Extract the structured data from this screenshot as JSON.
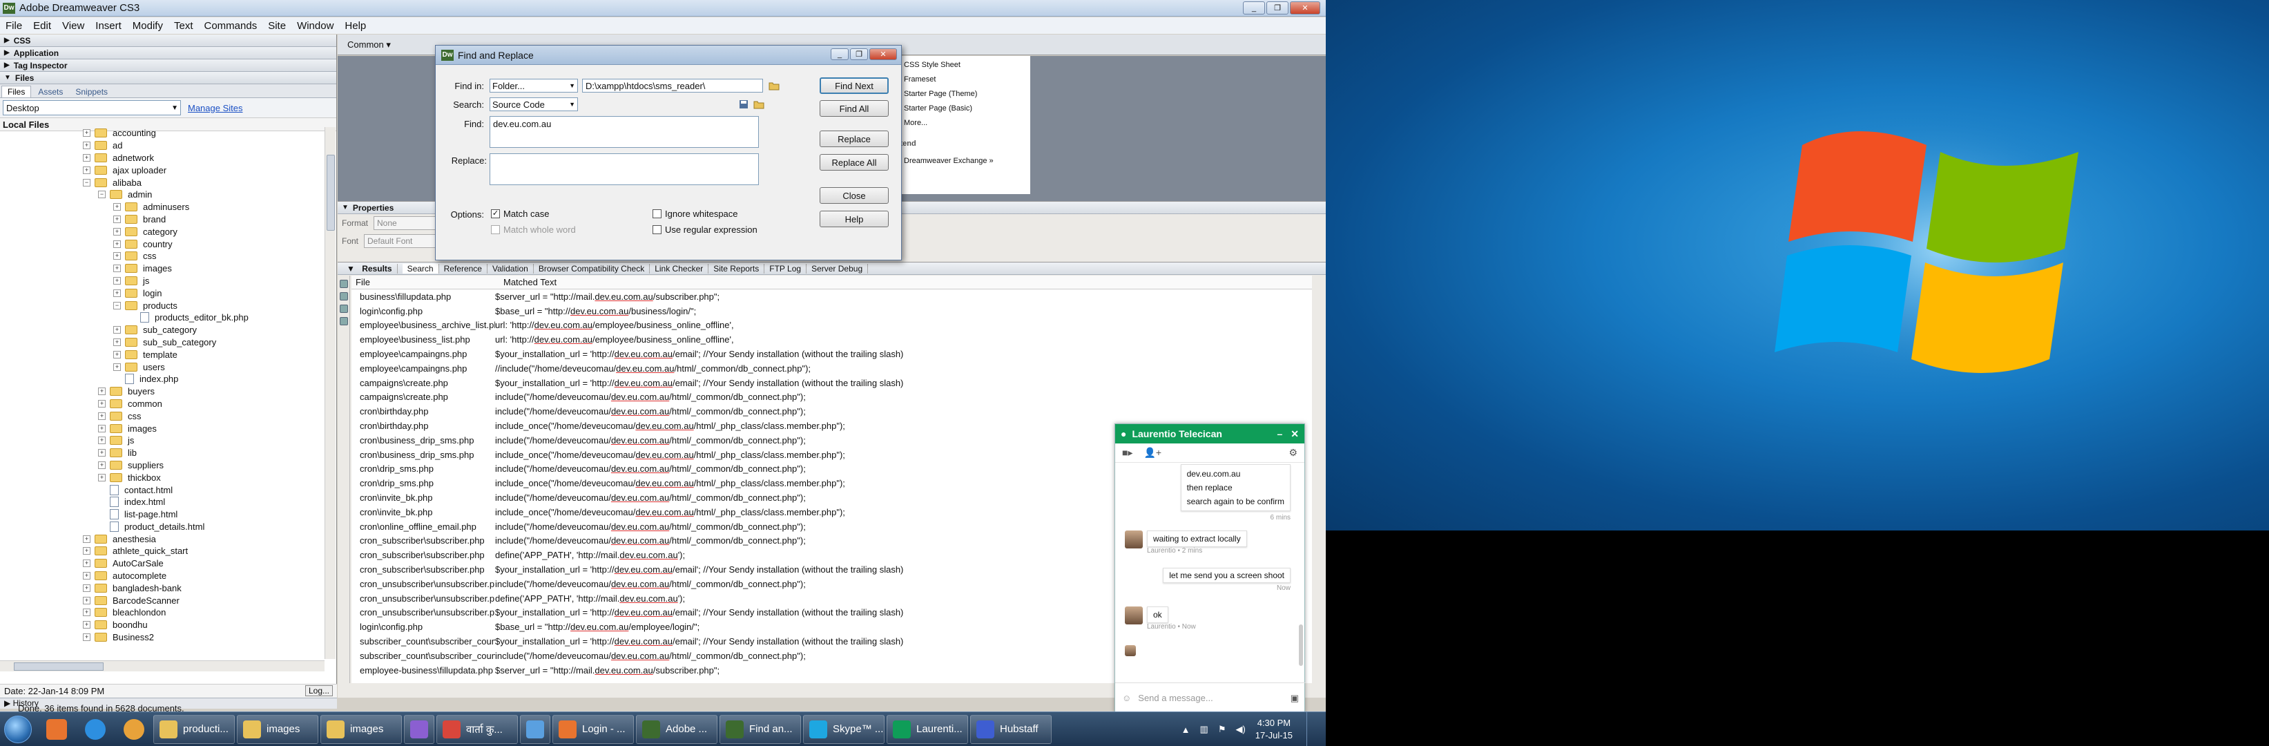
{
  "app": {
    "title": "Adobe Dreamweaver CS3",
    "window_controls": [
      "_",
      "❐",
      "✕"
    ]
  },
  "menu": [
    "File",
    "Edit",
    "View",
    "Insert",
    "Modify",
    "Text",
    "Commands",
    "Site",
    "Window",
    "Help"
  ],
  "panels": {
    "css": "CSS",
    "application": "Application",
    "tag_inspector": "Tag Inspector",
    "files": "Files",
    "files_tabs": [
      "Files",
      "Assets",
      "Snippets"
    ],
    "site": "Desktop",
    "manage_sites": "Manage Sites",
    "local_files": "Local Files",
    "status": "Date: 22-Jan-14 8:09 PM",
    "log_button": "Log...",
    "history": "History"
  },
  "tree": [
    {
      "name": "accounting",
      "level": 0,
      "type": "folder",
      "exp": "+"
    },
    {
      "name": "ad",
      "level": 0,
      "type": "folder",
      "exp": "+"
    },
    {
      "name": "adnetwork",
      "level": 0,
      "type": "folder",
      "exp": "+"
    },
    {
      "name": "ajax uploader",
      "level": 0,
      "type": "folder",
      "exp": "+"
    },
    {
      "name": "alibaba",
      "level": 0,
      "type": "folder",
      "exp": "−"
    },
    {
      "name": "admin",
      "level": 1,
      "type": "folder",
      "exp": "−"
    },
    {
      "name": "adminusers",
      "level": 2,
      "type": "folder",
      "exp": "+"
    },
    {
      "name": "brand",
      "level": 2,
      "type": "folder",
      "exp": "+"
    },
    {
      "name": "category",
      "level": 2,
      "type": "folder",
      "exp": "+"
    },
    {
      "name": "country",
      "level": 2,
      "type": "folder",
      "exp": "+"
    },
    {
      "name": "css",
      "level": 2,
      "type": "folder",
      "exp": "+"
    },
    {
      "name": "images",
      "level": 2,
      "type": "folder",
      "exp": "+"
    },
    {
      "name": "js",
      "level": 2,
      "type": "folder",
      "exp": "+"
    },
    {
      "name": "login",
      "level": 2,
      "type": "folder",
      "exp": "+"
    },
    {
      "name": "products",
      "level": 2,
      "type": "folder",
      "exp": "−"
    },
    {
      "name": "products_editor_bk.php",
      "level": 3,
      "type": "file",
      "exp": ""
    },
    {
      "name": "sub_category",
      "level": 2,
      "type": "folder",
      "exp": "+"
    },
    {
      "name": "sub_sub_category",
      "level": 2,
      "type": "folder",
      "exp": "+"
    },
    {
      "name": "template",
      "level": 2,
      "type": "folder",
      "exp": "+"
    },
    {
      "name": "users",
      "level": 2,
      "type": "folder",
      "exp": "+"
    },
    {
      "name": "index.php",
      "level": 2,
      "type": "file",
      "exp": ""
    },
    {
      "name": "buyers",
      "level": 1,
      "type": "folder",
      "exp": "+"
    },
    {
      "name": "common",
      "level": 1,
      "type": "folder",
      "exp": "+"
    },
    {
      "name": "css",
      "level": 1,
      "type": "folder",
      "exp": "+"
    },
    {
      "name": "images",
      "level": 1,
      "type": "folder",
      "exp": "+"
    },
    {
      "name": "js",
      "level": 1,
      "type": "folder",
      "exp": "+"
    },
    {
      "name": "lib",
      "level": 1,
      "type": "folder",
      "exp": "+"
    },
    {
      "name": "suppliers",
      "level": 1,
      "type": "folder",
      "exp": "+"
    },
    {
      "name": "thickbox",
      "level": 1,
      "type": "folder",
      "exp": "+"
    },
    {
      "name": "contact.html",
      "level": 1,
      "type": "file",
      "exp": ""
    },
    {
      "name": "index.html",
      "level": 1,
      "type": "file",
      "exp": ""
    },
    {
      "name": "list-page.html",
      "level": 1,
      "type": "file",
      "exp": ""
    },
    {
      "name": "product_details.html",
      "level": 1,
      "type": "file",
      "exp": ""
    },
    {
      "name": "anesthesia",
      "level": 0,
      "type": "folder",
      "exp": "+"
    },
    {
      "name": "athlete_quick_start",
      "level": 0,
      "type": "folder",
      "exp": "+"
    },
    {
      "name": "AutoCarSale",
      "level": 0,
      "type": "folder",
      "exp": "+"
    },
    {
      "name": "autocomplete",
      "level": 0,
      "type": "folder",
      "exp": "+"
    },
    {
      "name": "bangladesh-bank",
      "level": 0,
      "type": "folder",
      "exp": "+"
    },
    {
      "name": "BarcodeScanner",
      "level": 0,
      "type": "folder",
      "exp": "+"
    },
    {
      "name": "bleachlondon",
      "level": 0,
      "type": "folder",
      "exp": "+"
    },
    {
      "name": "boondhu",
      "level": 0,
      "type": "folder",
      "exp": "+"
    },
    {
      "name": "Business2",
      "level": 0,
      "type": "folder",
      "exp": "+"
    }
  ],
  "insert_bar": {
    "category": "Common ▾"
  },
  "start_page": {
    "items": [
      "CSS Style Sheet",
      "Frameset",
      "Starter Page (Theme)",
      "Starter Page (Basic)",
      "More..."
    ],
    "extend_label": "Extend",
    "extend_item": "Dreamweaver Exchange »"
  },
  "properties": {
    "title": "Properties",
    "format_label": "Format",
    "format_value": "None",
    "font_label": "Font",
    "font_value": "Default Font"
  },
  "results": {
    "title": "Results",
    "tabs": [
      "Search",
      "Reference",
      "Validation",
      "Browser Compatibility Check",
      "Link Checker",
      "Site Reports",
      "FTP Log",
      "Server Debug"
    ],
    "col_file": "File",
    "col_matched": "Matched Text",
    "rows": [
      {
        "file": "business\\fillupdata.php",
        "pre": "$server_url = \"http://mail.",
        "hl": "dev.eu.com.au",
        "post": "/subscriber.php\";"
      },
      {
        "file": "login\\config.php",
        "pre": "$base_url = \"http://",
        "hl": "dev.eu.com.au",
        "post": "/business/login/\";"
      },
      {
        "file": "employee\\business_archive_list.php",
        "pre": "url: 'http://",
        "hl": "dev.eu.com.au",
        "post": "/employee/business_online_offline',"
      },
      {
        "file": "employee\\business_list.php",
        "pre": "url: 'http://",
        "hl": "dev.eu.com.au",
        "post": "/employee/business_online_offline',"
      },
      {
        "file": "employee\\campaingns.php",
        "pre": "$your_installation_url = 'http://",
        "hl": "dev.eu.com.au",
        "post": "/email'; //Your Sendy installation (without the trailing slash)"
      },
      {
        "file": "employee\\campaingns.php",
        "pre": "//include(\"/home/deveucomau/",
        "hl": "dev.eu.com.au",
        "post": "/html/_common/db_connect.php\");"
      },
      {
        "file": "campaigns\\create.php",
        "pre": "$your_installation_url = 'http://",
        "hl": "dev.eu.com.au",
        "post": "/email'; //Your Sendy installation (without the trailing slash)"
      },
      {
        "file": "campaigns\\create.php",
        "pre": "include(\"/home/deveucomau/",
        "hl": "dev.eu.com.au",
        "post": "/html/_common/db_connect.php\");"
      },
      {
        "file": "cron\\birthday.php",
        "pre": "include(\"/home/deveucomau/",
        "hl": "dev.eu.com.au",
        "post": "/html/_common/db_connect.php\");"
      },
      {
        "file": "cron\\birthday.php",
        "pre": "include_once(\"/home/deveucomau/",
        "hl": "dev.eu.com.au",
        "post": "/html/_php_class/class.member.php\");"
      },
      {
        "file": "cron\\business_drip_sms.php",
        "pre": "include(\"/home/deveucomau/",
        "hl": "dev.eu.com.au",
        "post": "/html/_common/db_connect.php\");"
      },
      {
        "file": "cron\\business_drip_sms.php",
        "pre": "include_once(\"/home/deveucomau/",
        "hl": "dev.eu.com.au",
        "post": "/html/_php_class/class.member.php\");"
      },
      {
        "file": "cron\\drip_sms.php",
        "pre": "include(\"/home/deveucomau/",
        "hl": "dev.eu.com.au",
        "post": "/html/_common/db_connect.php\");"
      },
      {
        "file": "cron\\drip_sms.php",
        "pre": "include_once(\"/home/deveucomau/",
        "hl": "dev.eu.com.au",
        "post": "/html/_php_class/class.member.php\");"
      },
      {
        "file": "cron\\invite_bk.php",
        "pre": "include(\"/home/deveucomau/",
        "hl": "dev.eu.com.au",
        "post": "/html/_common/db_connect.php\");"
      },
      {
        "file": "cron\\invite_bk.php",
        "pre": "include_once(\"/home/deveucomau/",
        "hl": "dev.eu.com.au",
        "post": "/html/_php_class/class.member.php\");"
      },
      {
        "file": "cron\\online_offline_email.php",
        "pre": "include(\"/home/deveucomau/",
        "hl": "dev.eu.com.au",
        "post": "/html/_common/db_connect.php\");"
      },
      {
        "file": "cron_subscriber\\subscriber.php",
        "pre": "include(\"/home/deveucomau/",
        "hl": "dev.eu.com.au",
        "post": "/html/_common/db_connect.php\");"
      },
      {
        "file": "cron_subscriber\\subscriber.php",
        "pre": "define('APP_PATH', 'http://mail.",
        "hl": "dev.eu.com.au",
        "post": "');"
      },
      {
        "file": "cron_subscriber\\subscriber.php",
        "pre": "$your_installation_url = 'http://",
        "hl": "dev.eu.com.au",
        "post": "/email'; //Your Sendy installation (without the trailing slash)"
      },
      {
        "file": "cron_unsubscriber\\unsubscriber.php",
        "pre": "include(\"/home/deveucomau/",
        "hl": "dev.eu.com.au",
        "post": "/html/_common/db_connect.php\");"
      },
      {
        "file": "cron_unsubscriber\\unsubscriber.php",
        "pre": "define('APP_PATH', 'http://mail.",
        "hl": "dev.eu.com.au",
        "post": "');"
      },
      {
        "file": "cron_unsubscriber\\unsubscriber.php",
        "pre": "$your_installation_url = 'http://",
        "hl": "dev.eu.com.au",
        "post": "/email'; //Your Sendy installation (without the trailing slash)"
      },
      {
        "file": "login\\config.php",
        "pre": "$base_url = \"http://",
        "hl": "dev.eu.com.au",
        "post": "/employee/login/\";"
      },
      {
        "file": "subscriber_count\\subscriber_count.php",
        "pre": "$your_installation_url = 'http://",
        "hl": "dev.eu.com.au",
        "post": "/email'; //Your Sendy installation (without the trailing slash)"
      },
      {
        "file": "subscriber_count\\subscriber_count.php",
        "pre": "include(\"/home/deveucomau/",
        "hl": "dev.eu.com.au",
        "post": "/html/_common/db_connect.php\");"
      },
      {
        "file": "employee-business\\fillupdata.php",
        "pre": "$server_url = \"http://mail.",
        "hl": "dev.eu.com.au",
        "post": "/subscriber.php\";"
      }
    ],
    "status": "Done. 36 items found in 5628 documents."
  },
  "find_replace": {
    "title": "Find and Replace",
    "find_in_label": "Find in:",
    "find_in_value": "Folder...",
    "folder_path": "D:\\xampp\\htdocs\\sms_reader\\",
    "search_label": "Search:",
    "search_value": "Source Code",
    "find_label": "Find:",
    "find_value": "dev.eu.com.au",
    "replace_label": "Replace:",
    "replace_value": "",
    "options_label": "Options:",
    "match_case": "Match case",
    "match_whole_word": "Match whole word",
    "ignore_whitespace": "Ignore whitespace",
    "use_regex": "Use regular expression",
    "buttons": {
      "find_next": "Find Next",
      "find_all": "Find All",
      "replace": "Replace",
      "replace_all": "Replace All",
      "close": "Close",
      "help": "Help"
    }
  },
  "chat": {
    "contact": "Laurentio Telecican",
    "out_lines": [
      "dev.eu.com.au",
      "then replace",
      "search again to be confirm"
    ],
    "out_time": "6 mins",
    "in1": "waiting to extract locally",
    "in1_meta": "Laurentio • 2 mins",
    "out2": "let me send you a screen shoot",
    "out2_time": "Now",
    "in2": "ok",
    "in2_meta": "Laurentio • Now",
    "input_placeholder": "Send a message..."
  },
  "taskbar": {
    "items": [
      {
        "label": "producti...",
        "color": "#e8c25a"
      },
      {
        "label": "images",
        "color": "#e8c25a"
      },
      {
        "label": "images",
        "color": "#e8c25a"
      },
      {
        "label": "",
        "color": "#8b5fd1"
      },
      {
        "label": "वार्ता कु...",
        "color": "#d9463b"
      },
      {
        "label": "",
        "color": "#5aa0e0"
      },
      {
        "label": "Login - ...",
        "color": "#e8742f"
      },
      {
        "label": "Adobe ...",
        "color": "#3d6b2f"
      },
      {
        "label": "Find an...",
        "color": "#3d6b2f"
      },
      {
        "label": "Skype™ ...",
        "color": "#1ea7e1"
      },
      {
        "label": "Laurenti...",
        "color": "#0f9d58"
      },
      {
        "label": "Hubstaff",
        "color": "#3e5ed1"
      }
    ],
    "time": "4:30 PM",
    "date": "17-Jul-15"
  }
}
